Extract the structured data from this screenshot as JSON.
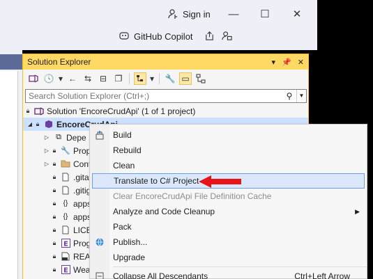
{
  "titlebar": {
    "sign_in": "Sign in",
    "copilot": "GitHub Copilot"
  },
  "solution_explorer": {
    "title": "Solution Explorer",
    "search_placeholder": "Search Solution Explorer (Ctrl+;)",
    "tree": [
      {
        "label": "Solution 'EncoreCrudApi' (1 of 1 project)",
        "icon": "solution-icon"
      },
      {
        "label": "EncoreCrudApi",
        "icon": "project-icon"
      },
      {
        "label": "Depe",
        "icon": "dependencies-icon"
      },
      {
        "label": "Prop",
        "icon": "properties-icon"
      },
      {
        "label": "Cont",
        "icon": "folder-icon"
      },
      {
        "label": ".gita",
        "icon": "file-icon"
      },
      {
        "label": ".gitig",
        "icon": "file-icon"
      },
      {
        "label": "apps",
        "icon": "json-icon"
      },
      {
        "label": "apps",
        "icon": "json-icon"
      },
      {
        "label": "LICE",
        "icon": "file-icon"
      },
      {
        "label": "Prog",
        "icon": "encore-file-icon"
      },
      {
        "label": "REA",
        "icon": "markdown-icon"
      },
      {
        "label": "Wea",
        "icon": "encore-file-icon"
      }
    ]
  },
  "context_menu": {
    "items": [
      {
        "label": "Build",
        "icon": "build-icon"
      },
      {
        "label": "Rebuild"
      },
      {
        "label": "Clean"
      },
      {
        "label": "Translate to C# Project",
        "highlighted": true
      },
      {
        "label": "Clear EncoreCrudApi File Definition Cache",
        "disabled": true
      },
      {
        "label": "Analyze and Code Cleanup",
        "submenu": true
      },
      {
        "label": "Pack"
      },
      {
        "label": "Publish...",
        "icon": "globe-icon"
      },
      {
        "label": "Upgrade"
      },
      {
        "label": "Collapse All Descendants",
        "shortcut": "Ctrl+Left Arrow",
        "icon": "collapse-icon"
      }
    ]
  },
  "colors": {
    "header_accent": "#ffd964",
    "highlight": "#dbe8fb",
    "arrow": "#e8121b"
  }
}
